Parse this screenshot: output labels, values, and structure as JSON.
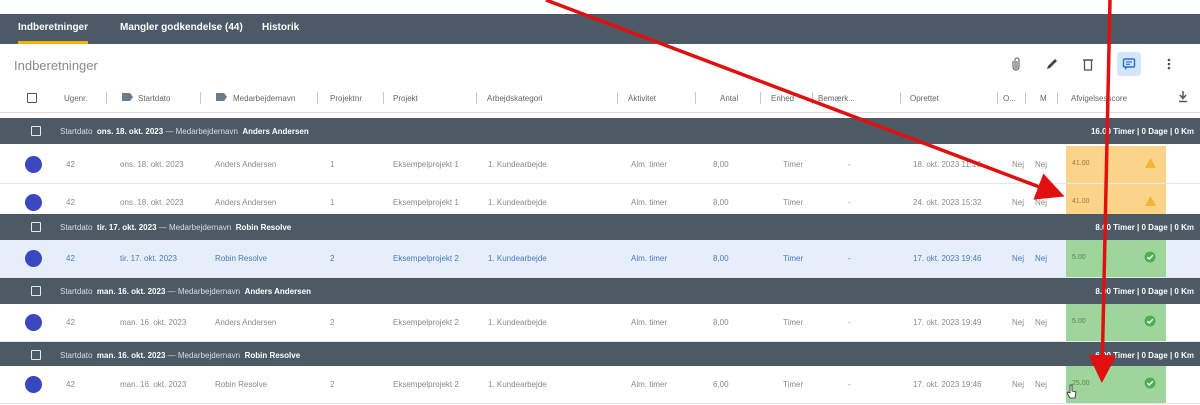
{
  "tabs": [
    {
      "label": "Indberetninger",
      "active": true
    },
    {
      "label": "Mangler godkendelse (44)"
    },
    {
      "label": "Historik"
    }
  ],
  "page_title": "Indberetninger",
  "toolbar": {
    "icons": [
      "paperclip-icon",
      "pencil-icon",
      "trash-icon",
      "comment-icon",
      "more-vert-icon"
    ],
    "selected": "comment-icon"
  },
  "columns": {
    "ugenr": "Ugenr.",
    "startdato": "Startdato",
    "medarbejdernavn": "Medarbejdernavn",
    "projektnr": "Projektnr",
    "projekt": "Projekt",
    "arbejdskategori": "Arbejdskategori",
    "aktivitet": "Aktivitet",
    "antal": "Antal",
    "enhed": "Enhed",
    "bemaerk": "Bemærk...",
    "oprettet": "Oprettet",
    "o": "O...",
    "m": "M",
    "afvigelsesscore": "Afvigelsesscore"
  },
  "groups": [
    {
      "label_start": "Startdato",
      "date": "ons. 18. okt. 2023",
      "label_name": "— Medarbejdernavn",
      "name": "Anders Andersen",
      "summary": "16.00 Timer | 0 Dage | 0 Km",
      "rows": [
        {
          "ugenr": "42",
          "startdato": "ons. 18. okt. 2023",
          "navn": "Anders Andersen",
          "projektnr": "1",
          "projekt": "Eksempelprojekt 1",
          "kategori": "1. Kundearbejde",
          "aktivitet": "Alm. timer",
          "antal": "8,00",
          "enhed": "Timer",
          "bemaerk": "-",
          "oprettet": "18. okt. 2023 11:18",
          "o": "Nej",
          "m": "Nej",
          "score": "41.00",
          "status": "warn"
        },
        {
          "ugenr": "42",
          "startdato": "ons. 18. okt. 2023",
          "navn": "Anders Andersen",
          "projektnr": "1",
          "projekt": "Eksempelprojekt 1",
          "kategori": "1. Kundearbejde",
          "aktivitet": "Alm. timer",
          "antal": "8,00",
          "enhed": "Timer",
          "bemaerk": "-",
          "oprettet": "24. okt. 2023 15:32",
          "o": "Nej",
          "m": "Nej",
          "score": "41.00",
          "status": "warn"
        }
      ]
    },
    {
      "label_start": "Startdato",
      "date": "tir. 17. okt. 2023",
      "label_name": "— Medarbejdernavn",
      "name": "Robin Resolve",
      "summary": "8.00 Timer | 0 Dage | 0 Km",
      "rows": [
        {
          "ugenr": "42",
          "startdato": "tir. 17. okt. 2023",
          "navn": "Robin Resolve",
          "projektnr": "2",
          "projekt": "Eksempelprojekt 2",
          "kategori": "1. Kundearbejde",
          "aktivitet": "Alm. timer",
          "antal": "8,00",
          "enhed": "Timer",
          "bemaerk": "-",
          "oprettet": "17. okt. 2023 19:46",
          "o": "Nej",
          "m": "Nej",
          "score": "5.00",
          "status": "ok",
          "highlight": true
        }
      ]
    },
    {
      "label_start": "Startdato",
      "date": "man. 16. okt. 2023",
      "label_name": "— Medarbejdernavn",
      "name": "Anders Andersen",
      "summary": "8.00 Timer | 0 Dage | 0 Km",
      "rows": [
        {
          "ugenr": "42",
          "startdato": "man. 16. okt. 2023",
          "navn": "Anders Andersen",
          "projektnr": "2",
          "projekt": "Eksempelprojekt 2",
          "kategori": "1. Kundearbejde",
          "aktivitet": "Alm. timer",
          "antal": "8,00",
          "enhed": "Timer",
          "bemaerk": "-",
          "oprettet": "17. okt. 2023 19:49",
          "o": "Nej",
          "m": "Nej",
          "score": "5.00",
          "status": "ok"
        }
      ]
    },
    {
      "label_start": "Startdato",
      "date": "man. 16. okt. 2023",
      "label_name": "— Medarbejdernavn",
      "name": "Robin Resolve",
      "summary": "6.00 Timer | 0 Dage | 0 Km",
      "rows": [
        {
          "ugenr": "42",
          "startdato": "man. 16. okt. 2023",
          "navn": "Robin Resolve",
          "projektnr": "2",
          "projekt": "Eksempelprojekt 2",
          "kategori": "1. Kundearbejde",
          "aktivitet": "Alm. timer",
          "antal": "6,00",
          "enhed": "Timer",
          "bemaerk": "-",
          "oprettet": "17. okt. 2023 19:46",
          "o": "Nej",
          "m": "Nej",
          "score": "25.00",
          "status": "ok"
        }
      ]
    }
  ],
  "colors": {
    "tab_bar": "#4b5a66",
    "active_tab_underline": "#f0b400",
    "group_header": "#4c5a66",
    "warn_score": "#fbd48a",
    "ok_score": "#9ed59a",
    "annotation_arrow": "#e01010",
    "user_dot": "#3a48c0"
  }
}
